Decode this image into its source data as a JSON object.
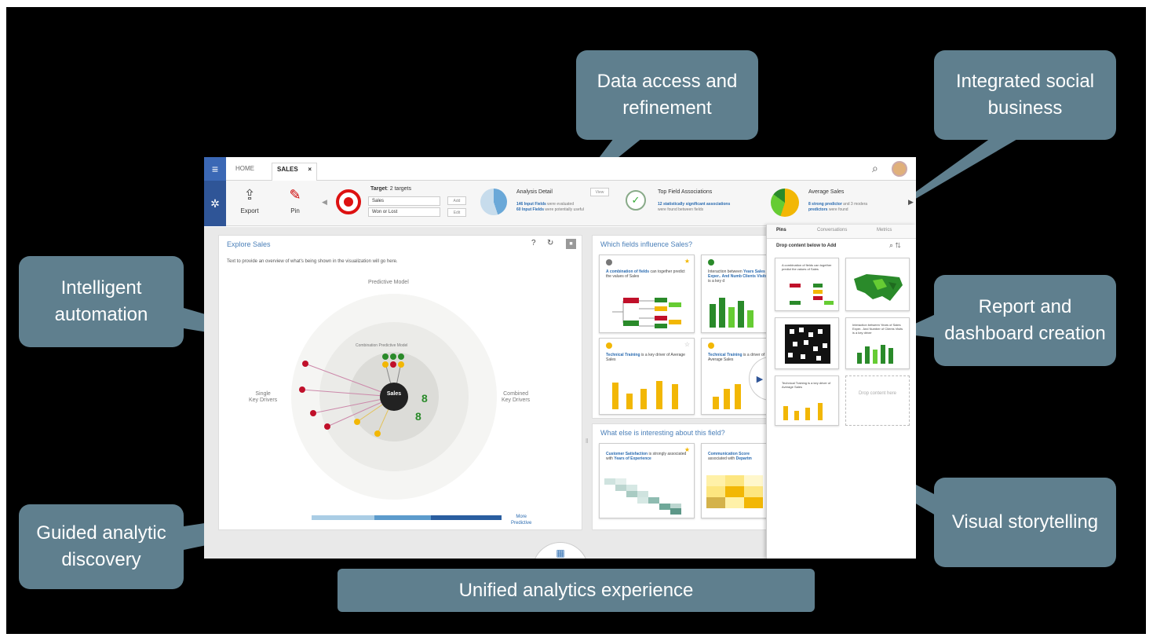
{
  "callouts": {
    "data_access": "Data access and refinement",
    "social": "Integrated social business",
    "intelligent": "Intelligent automation",
    "report": "Report and dashboard creation",
    "guided": "Guided analytic discovery",
    "storytelling": "Visual storytelling",
    "unified": "Unified analytics experience"
  },
  "app": {
    "tabs": {
      "home": "HOME",
      "sales": "SALES",
      "close": "×"
    },
    "toolbar": {
      "export": "Export",
      "pin": "Pin",
      "target_prefix": "Target",
      "target_value": ": 2 targets",
      "target1": "Sales",
      "target2": "Won or Lost",
      "add": "Add",
      "edit": "Edit",
      "analysis_title": "Analysis Detail",
      "analysis_line1_bold": "146 Input Fields",
      "analysis_line1": " were evaluated",
      "analysis_line2_bold": "60 Input Fields",
      "analysis_line2": " were potentially useful",
      "view": "View",
      "assoc_title": "Top Field Associations",
      "assoc_line1_bold": "12 statistically significant associations",
      "assoc_line2": "were found between fields",
      "avg_title": "Average Sales",
      "avg_line1_bold": "8 strong predictor",
      "avg_line1": " and 3 modera",
      "avg_line2_bold": "predictors",
      "avg_line2": " were found"
    },
    "explore": {
      "title": "Explore Sales",
      "description": "Text to provide an overview of what's being shown in the visualization will go here.",
      "predictive_model": "Predictive Model",
      "combination_model": "Combination Predictive Model",
      "single_drivers_l1": "Single",
      "single_drivers_l2": "Key Drivers",
      "combined_drivers_l1": "Combined",
      "combined_drivers_l2": "Key Drivers",
      "center": "Sales",
      "more_predictive_l1": "More",
      "more_predictive_l2": "Predictive",
      "help": "?",
      "undo": "↻",
      "stop": "■"
    },
    "influence": {
      "title": "Which fields influence Sales?",
      "card1_bold": "A combination of fields",
      "card1": " can together predict the values of Sales",
      "card2": "Interaction between ",
      "card2_bold": "Years Sales Exper.. And Numb Clients Visits",
      "card2_end": " is a key d",
      "card3_bold": "Technical Training",
      "card3": " is a key driver of Average Sales",
      "card4_bold": "Technical Training",
      "card4": " is a driver of Average Sales"
    },
    "interesting": {
      "title": "What else is interesting about this field?",
      "card1_bold": "Customer Satisfaction",
      "card1": " is strongly associated with ",
      "card1_bold2": "Years of Experience",
      "card2_bold": "Communication Score",
      "card2": " associated with ",
      "card2_bold2": "Departm"
    },
    "pins": {
      "tab_pins": "Pins",
      "tab_conversations": "Conversations",
      "tab_metrics": "Metrics",
      "hint": "Drop content below to Add",
      "pin1": "A combination of fields can together predict the values of Sales",
      "pin4": "Interaction between Years of Sales Exper.. And Number of Clients Visits is a key driver",
      "pin5": "Technical Training is a key driver of Average Sales",
      "drop": "Drop content here"
    }
  },
  "colors": {
    "callout": "#5f7f8e",
    "brand_blue": "#2f5597",
    "accent_yellow": "#f2b705",
    "accent_green": "#2a8a2a",
    "accent_red": "#c0102a"
  }
}
